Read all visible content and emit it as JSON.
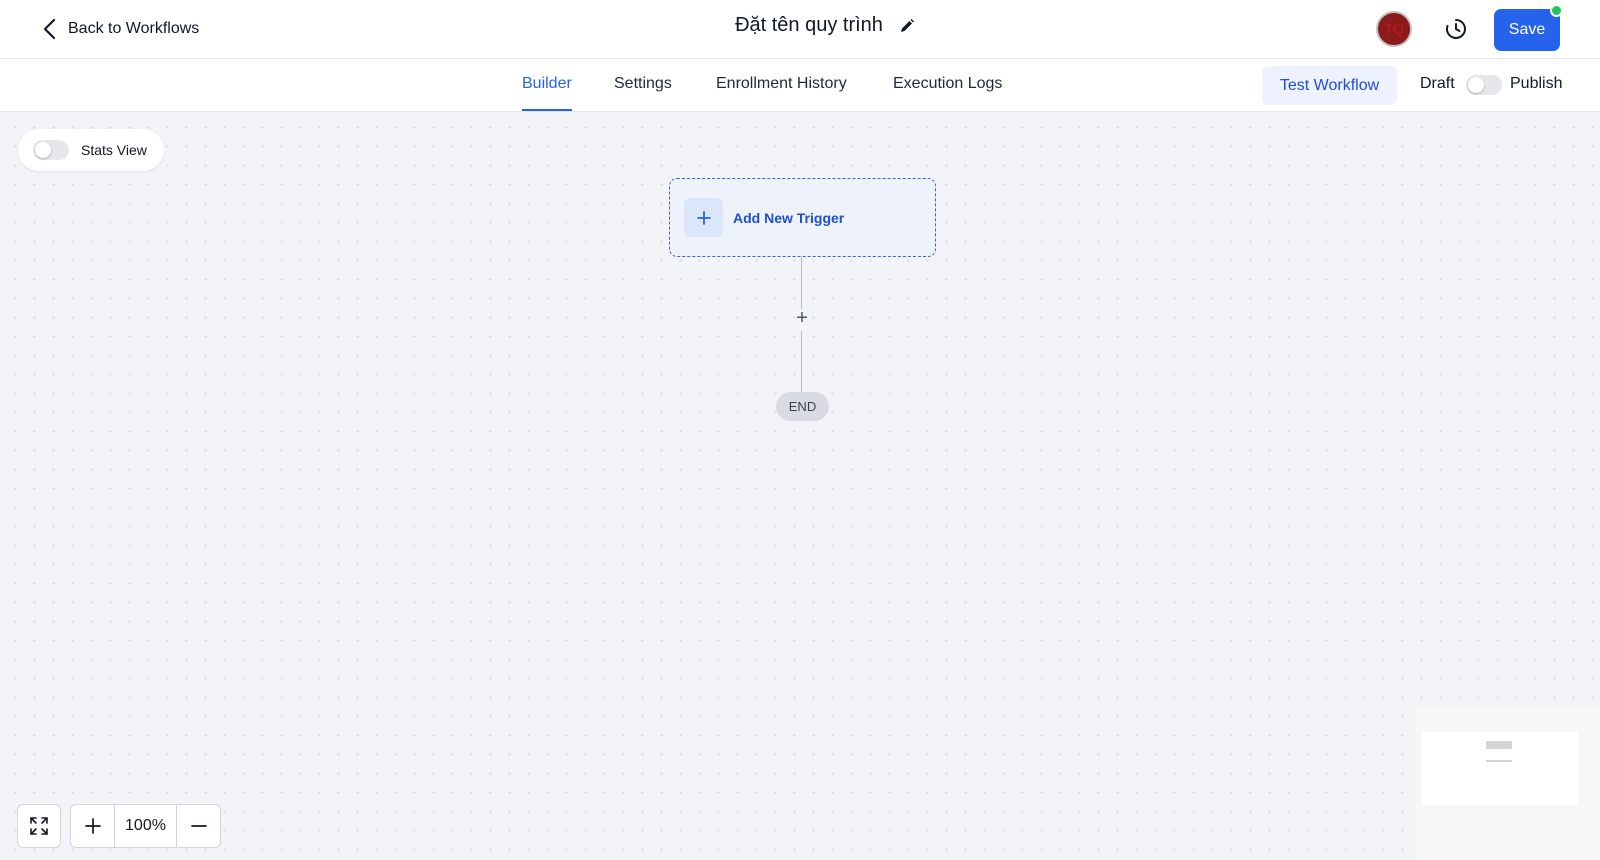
{
  "header": {
    "back_label": "Back to Workflows",
    "workflow_title": "Đặt tên quy trình",
    "avatar_initials": "TQ",
    "save_label": "Save"
  },
  "tabs": [
    {
      "label": "Builder",
      "active": true
    },
    {
      "label": "Settings",
      "active": false
    },
    {
      "label": "Enrollment History",
      "active": false
    },
    {
      "label": "Execution Logs",
      "active": false
    }
  ],
  "actions": {
    "test_label": "Test Workflow",
    "draft_label": "Draft",
    "publish_label": "Publish",
    "published": false
  },
  "canvas": {
    "stats_label": "Stats View",
    "stats_enabled": false,
    "trigger_label": "Add New Trigger",
    "add_step_symbol": "+",
    "end_label": "END"
  },
  "zoom": {
    "value": "100%"
  },
  "colors": {
    "accent": "#2563eb",
    "status_dot": "#22c55e",
    "avatar_bg": "#8b1a1a"
  }
}
